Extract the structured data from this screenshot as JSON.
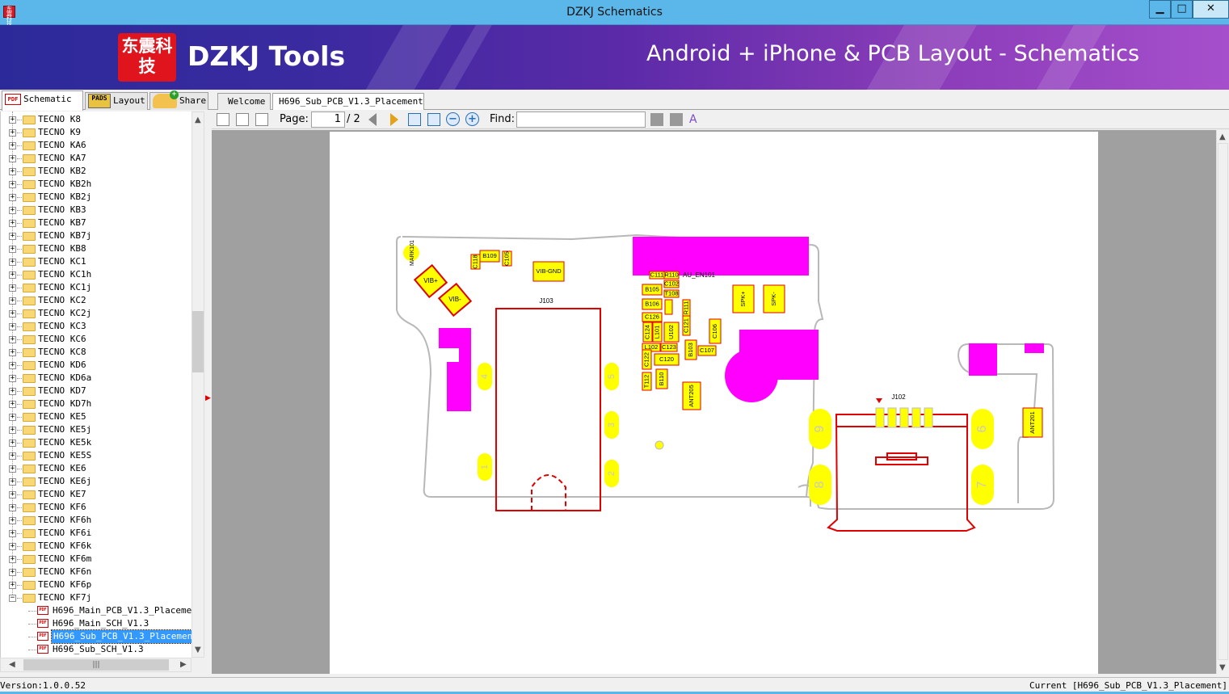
{
  "window": {
    "title": "DZKJ Schematics",
    "app_icon_text": "东震科技"
  },
  "banner": {
    "logo_text": "东震科技",
    "brand": "DZKJ Tools",
    "tagline": "Android + iPhone & PCB Layout - Schematics"
  },
  "left_tabs": [
    {
      "label": "Schematic",
      "icon": "pdf-icon",
      "icon_text": "PDF"
    },
    {
      "label": "Layout",
      "icon": "pads-icon",
      "icon_text": "PADS"
    },
    {
      "label": "Share",
      "icon": "share-icon"
    }
  ],
  "tree": {
    "folders": [
      "TECNO K8",
      "TECNO K9",
      "TECNO KA6",
      "TECNO KA7",
      "TECNO KB2",
      "TECNO KB2h",
      "TECNO KB2j",
      "TECNO KB3",
      "TECNO KB7",
      "TECNO KB7j",
      "TECNO KB8",
      "TECNO KC1",
      "TECNO KC1h",
      "TECNO KC1j",
      "TECNO KC2",
      "TECNO KC2j",
      "TECNO KC3",
      "TECNO KC6",
      "TECNO KC8",
      "TECNO KD6",
      "TECNO KD6a",
      "TECNO KD7",
      "TECNO KD7h",
      "TECNO KE5",
      "TECNO KE5j",
      "TECNO KE5k",
      "TECNO KE5S",
      "TECNO KE6",
      "TECNO KE6j",
      "TECNO KE7",
      "TECNO KF6",
      "TECNO KF6h",
      "TECNO KF6i",
      "TECNO KF6k",
      "TECNO KF6m",
      "TECNO KF6n",
      "TECNO KF6p",
      "TECNO KF7j"
    ],
    "files": [
      "H696_Main_PCB_V1.3_Placement",
      "H696_Main_SCH_V1.3",
      "H696_Sub_PCB_V1.3_Placement",
      "H696_Sub_SCH_V1.3"
    ],
    "selected_file_index": 2
  },
  "doc_tabs": [
    {
      "label": "Welcome"
    },
    {
      "label": "H696_Sub_PCB_V1.3_Placement",
      "close": "×"
    }
  ],
  "toolbar": {
    "page_label": "Page:",
    "page_current": "1",
    "page_total": "/ 2",
    "find_label": "Find:",
    "find_value": ""
  },
  "pcb": {
    "labels": [
      "MARK101",
      "C118",
      "B109",
      "C105",
      "VIB-GND",
      "VIB+",
      "VIB-",
      "J103",
      "C111",
      "R110",
      "C102",
      "AU_EN101",
      "B105",
      "T108",
      "B106",
      "C107_R",
      "R111",
      "C126",
      "C124",
      "L101",
      "U102",
      "C121",
      "C106",
      "L102",
      "C123",
      "B103",
      "C107",
      "C122",
      "C120",
      "T112",
      "B110",
      "ANT205",
      "SPK+",
      "SPK-",
      "J102",
      "ANT201",
      "4",
      "5",
      "3",
      "1",
      "2",
      "9",
      "6",
      "8",
      "7"
    ],
    "colors": {
      "outline": "#b8b8b8",
      "copper": "#ff00ff",
      "part": "#ffff00",
      "part_outline": "#e00000",
      "connector": "#e00000"
    }
  },
  "status": {
    "version": "Version:1.0.0.52",
    "current": "Current [H696_Sub_PCB_V1.3_Placement]"
  }
}
